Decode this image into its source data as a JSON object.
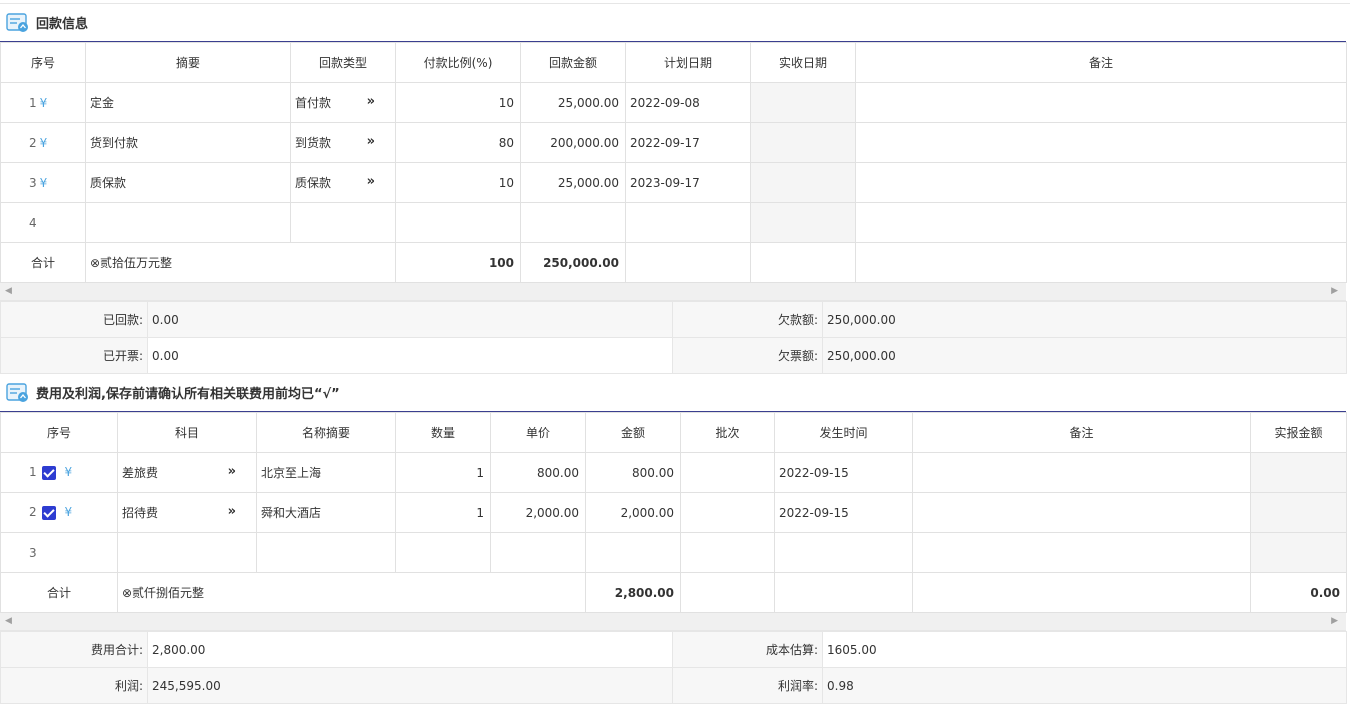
{
  "section1": {
    "title": "回款信息",
    "headers": [
      "序号",
      "摘要",
      "回款类型",
      "付款比例(%)",
      "回款金额",
      "计划日期",
      "实收日期",
      "备注"
    ],
    "rows": [
      {
        "no": "1",
        "summary": "定金",
        "type": "首付款",
        "ratio": "10",
        "amount": "25,000.00",
        "plan_date": "2022-09-08",
        "actual_date": "",
        "remark": ""
      },
      {
        "no": "2",
        "summary": "货到付款",
        "type": "到货款",
        "ratio": "80",
        "amount": "200,000.00",
        "plan_date": "2022-09-17",
        "actual_date": "",
        "remark": ""
      },
      {
        "no": "3",
        "summary": "质保款",
        "type": "质保款",
        "ratio": "10",
        "amount": "25,000.00",
        "plan_date": "2023-09-17",
        "actual_date": "",
        "remark": ""
      },
      {
        "no": "4"
      }
    ],
    "total": {
      "label": "合计",
      "text": "⊗贰拾伍万元整",
      "ratio": "100",
      "amount": "250,000.00"
    },
    "summary": {
      "received_label": "已回款:",
      "received": "0.00",
      "owed_label": "欠款额:",
      "owed": "250,000.00",
      "invoiced_label": "已开票:",
      "invoiced": "0.00",
      "owed_invoice_label": "欠票额:",
      "owed_invoice": "250,000.00"
    }
  },
  "section2": {
    "title": "费用及利润,保存前请确认所有相关联费用前均已“√”",
    "headers": [
      "序号",
      "科目",
      "名称摘要",
      "数量",
      "单价",
      "金额",
      "批次",
      "发生时间",
      "备注",
      "实报金额"
    ],
    "rows": [
      {
        "no": "1",
        "subject": "差旅费",
        "name": "北京至上海",
        "qty": "1",
        "price": "800.00",
        "amount": "800.00",
        "batch": "",
        "time": "2022-09-15",
        "remark": "",
        "actual": ""
      },
      {
        "no": "2",
        "subject": "招待费",
        "name": "舜和大酒店",
        "qty": "1",
        "price": "2,000.00",
        "amount": "2,000.00",
        "batch": "",
        "time": "2022-09-15",
        "remark": "",
        "actual": ""
      },
      {
        "no": "3"
      }
    ],
    "total": {
      "label": "合计",
      "text": "⊗贰仟捌佰元整",
      "amount": "2,800.00",
      "actual": "0.00"
    },
    "summary": {
      "cost_total_label": "费用合计:",
      "cost_total": "2,800.00",
      "estimate_label": "成本估算:",
      "estimate": "1605.00",
      "profit_label": "利润:",
      "profit": "245,595.00",
      "profit_rate_label": "利润率:",
      "profit_rate": "0.98"
    }
  },
  "icons": {
    "yen": "¥",
    "arrow": "»",
    "scroll_left": "◀",
    "scroll_right": "▶"
  }
}
